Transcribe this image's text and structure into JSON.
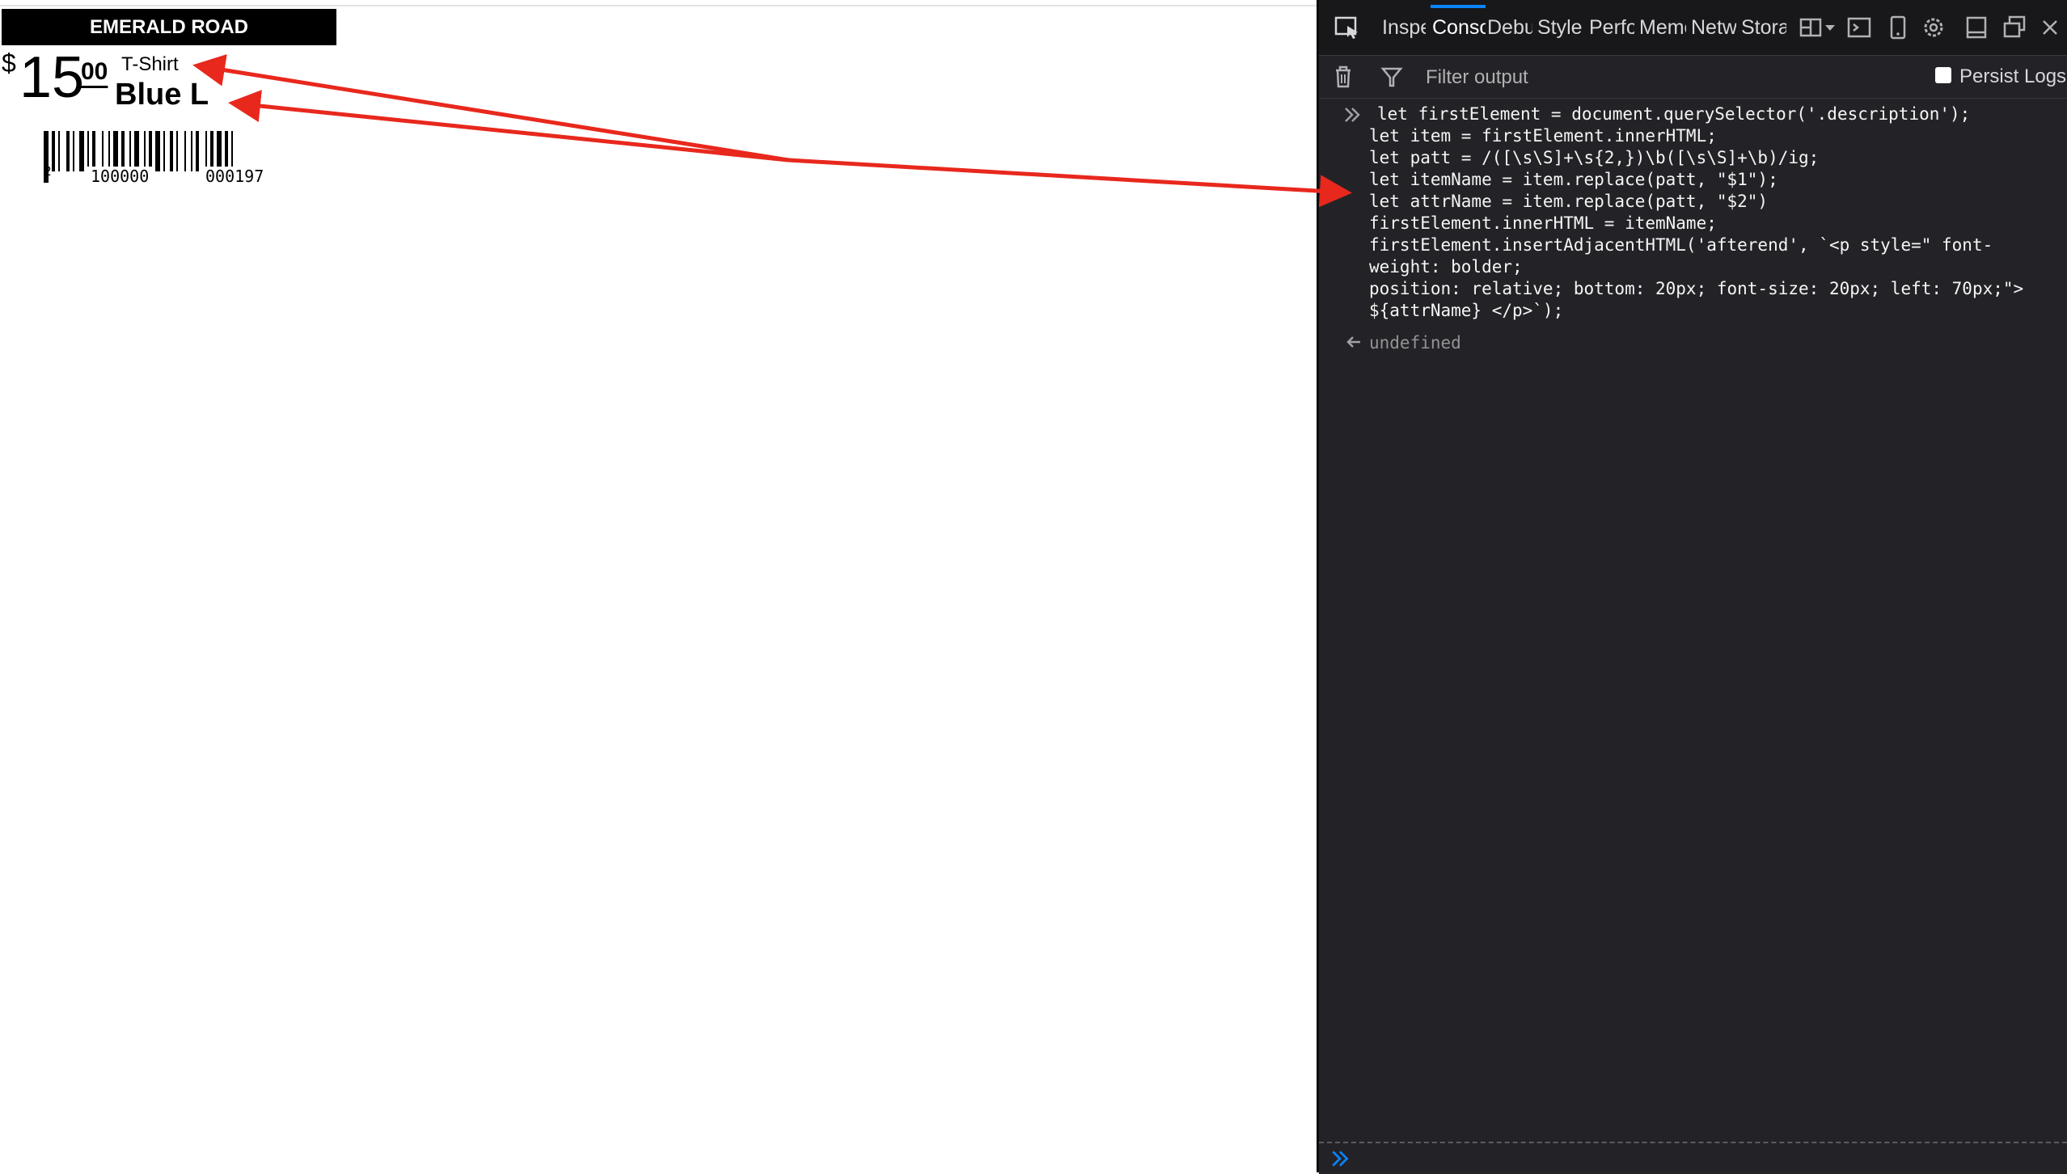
{
  "label": {
    "store_name": "EMERALD ROAD",
    "currency": "$",
    "price_dollars": "15",
    "price_cents": "00",
    "item_name": "T-Shirt",
    "item_attribute": "Blue L",
    "barcode": {
      "lead_digit": "2",
      "left_digits": "100000",
      "right_digits": "000197"
    }
  },
  "devtools": {
    "tabs": [
      {
        "label": "Inspector",
        "active": false
      },
      {
        "label": "Console",
        "active": true
      },
      {
        "label": "Debugger",
        "active": false
      },
      {
        "label": "Style Editor",
        "active": false
      },
      {
        "label": "Performance",
        "active": false
      },
      {
        "label": "Memory",
        "active": false
      },
      {
        "label": "Network",
        "active": false
      },
      {
        "label": "Storage",
        "active": false
      }
    ],
    "filter": {
      "placeholder": "Filter output"
    },
    "persist_logs_label": "Persist Logs",
    "console": {
      "input_lines": [
        "let firstElement = document.querySelector('.description');",
        "let item = firstElement.innerHTML;",
        "let patt = /([\\s\\S]+\\s{2,})\\b([\\s\\S]+\\b)/ig;",
        "let itemName = item.replace(patt, \"$1\");",
        "let attrName = item.replace(patt, \"$2\")",
        "firstElement.innerHTML = itemName;",
        "firstElement.insertAdjacentHTML('afterend', `<p style=\" font-",
        "weight: bolder;",
        "position: relative; bottom: 20px; font-size: 20px; left: 70px;\">",
        "${attrName} </p>`);"
      ],
      "result": "undefined"
    }
  },
  "colors": {
    "arrow": "#e8281d",
    "devtools_bg": "#232327",
    "tab_highlight": "#0a84ff"
  }
}
